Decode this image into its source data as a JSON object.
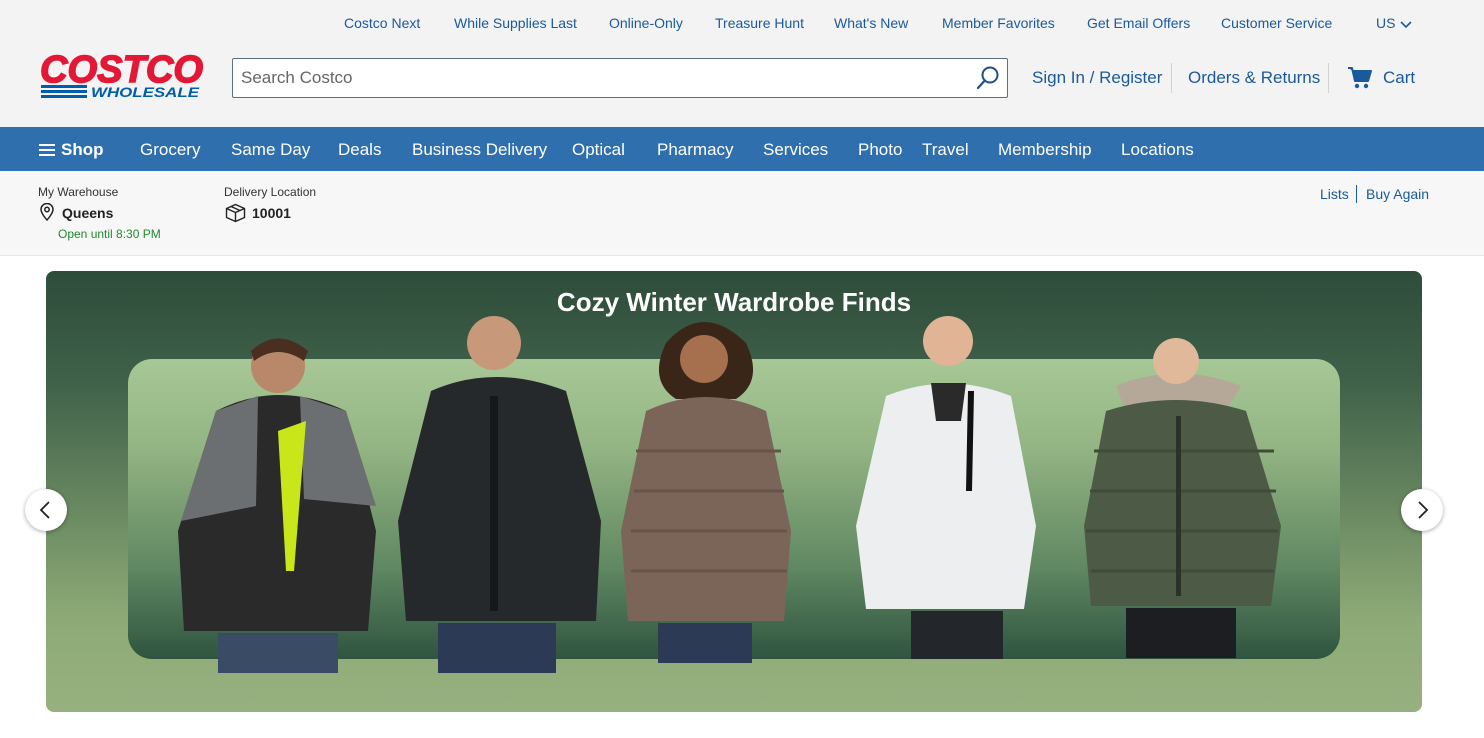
{
  "utility_nav": {
    "links": [
      "Costco Next",
      "While Supplies Last",
      "Online-Only",
      "Treasure Hunt",
      "What's New",
      "Member Favorites",
      "Get Email Offers",
      "Customer Service"
    ],
    "country": "US"
  },
  "logo": {
    "line1": "COSTCO",
    "line2": "WHOLESALE"
  },
  "search": {
    "placeholder": "Search Costco",
    "value": ""
  },
  "account": {
    "sign_in": "Sign In / Register",
    "orders": "Orders & Returns",
    "cart": "Cart"
  },
  "main_nav": {
    "shop": "Shop",
    "items": [
      "Grocery",
      "Same Day",
      "Deals",
      "Business Delivery",
      "Optical",
      "Pharmacy",
      "Services",
      "Photo",
      "Travel",
      "Membership",
      "Locations"
    ]
  },
  "warehouse": {
    "label": "My Warehouse",
    "name": "Queens",
    "hours": "Open until 8:30 PM"
  },
  "delivery": {
    "label": "Delivery Location",
    "zip": "10001"
  },
  "quick_links": {
    "lists": "Lists",
    "buy_again": "Buy Again"
  },
  "hero": {
    "title": "Cozy Winter Wardrobe Finds"
  },
  "colors": {
    "brand_red": "#e31837",
    "brand_blue": "#005daa",
    "nav_blue": "#2f6fae",
    "link_blue": "#1a5a9c",
    "open_green": "#1d8a2c"
  },
  "icons": [
    "search-icon",
    "chevron-down-icon",
    "cart-icon",
    "menu-icon",
    "location-pin-icon",
    "package-icon",
    "chevron-left-icon",
    "chevron-right-icon"
  ]
}
